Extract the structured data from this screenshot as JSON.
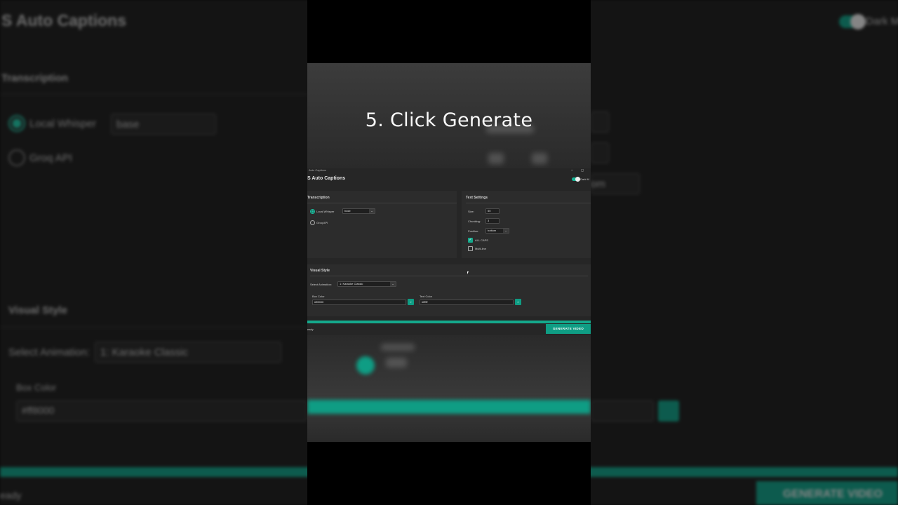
{
  "caption": "5. Click Generate",
  "app": {
    "window_title": "Auto Captions",
    "title": "S Auto Captions",
    "dark_mode_label": "Dark M",
    "transcription": {
      "title": "Transcription",
      "options": [
        {
          "label": "Local Whisper",
          "selected": true
        },
        {
          "label": "Groq API",
          "selected": false
        }
      ],
      "model_value": "base"
    },
    "text_settings": {
      "title": "Text Settings",
      "size_label": "Size:",
      "size_value": "50",
      "chunking_label": "Chunking:",
      "chunking_value": "3",
      "position_label": "Position:",
      "position_value": "bottom",
      "all_caps_label": "ALL CAPS",
      "all_caps_checked": true,
      "multi_line_label": "Multi-line",
      "multi_line_checked": false
    },
    "visual_style": {
      "title": "Visual Style",
      "animation_label": "Select Animation:",
      "animation_value": "1: Karaoke Classic",
      "box_color_label": "Box Color",
      "box_color_value": "#ff8000",
      "text_color_label": "Text Color",
      "text_color_value": "#ffffff"
    },
    "status": "eady",
    "generate_label": "GENERATE VIDEO",
    "accent_color": "#0f9d84"
  },
  "background": {
    "title": "S Auto Captions",
    "dark_label": "Dark M",
    "transcription": "Transcription",
    "local_whisper": "Local Whisper",
    "model": "base",
    "groq": "Groq API",
    "visual_style": "Visual Style",
    "select_animation": "Select Animation:",
    "animation_value": "1: Karaoke Classic",
    "box_color": "Box Color",
    "box_color_value": "#ff8000",
    "position_value": "om",
    "status": "eady",
    "generate": "GENERATE VIDEO"
  }
}
